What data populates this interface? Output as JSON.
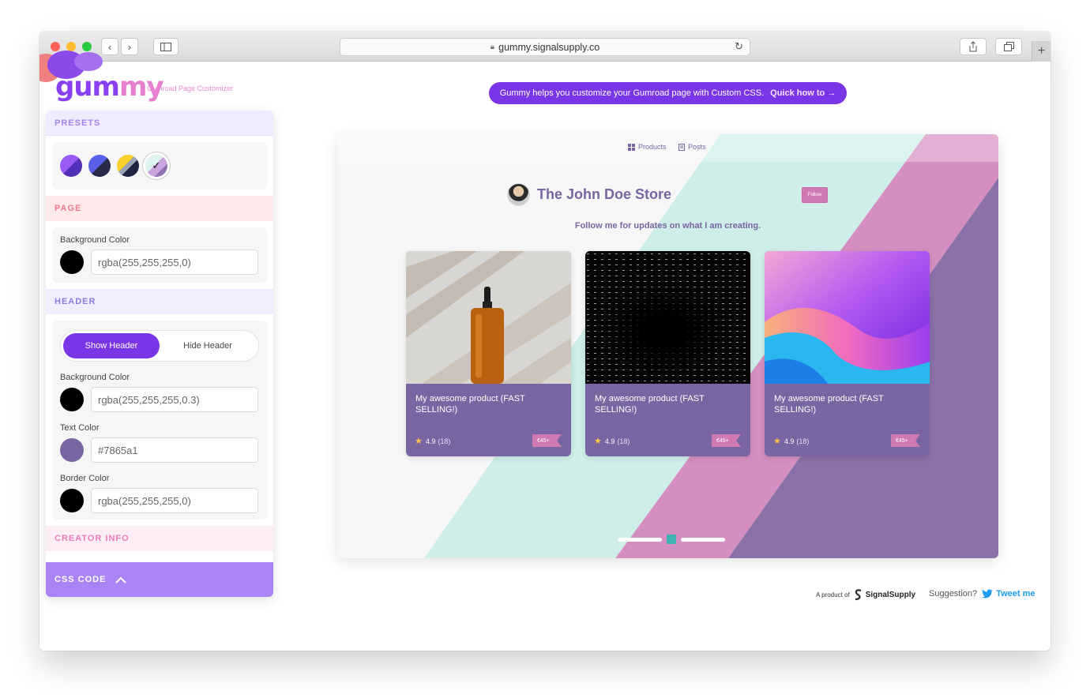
{
  "browser": {
    "url": "gummy.signalsupply.co"
  },
  "logo": {
    "name_a": "gum",
    "name_b": "my",
    "tagline": "Gumroad Page Customizer"
  },
  "sidebar": {
    "presets_title": "PRESETS",
    "page_title": "PAGE",
    "page": {
      "bg_label": "Background Color",
      "bg_value": "rgba(255,255,255,0)"
    },
    "header_title": "HEADER",
    "header": {
      "show_label": "Show Header",
      "hide_label": "Hide Header",
      "bg_label": "Background Color",
      "bg_value": "rgba(255,255,255,0.3)",
      "text_label": "Text Color",
      "text_value": "#7865a1",
      "border_label": "Border Color",
      "border_value": "rgba(255,255,255,0)"
    },
    "creator_title": "CREATOR INFO",
    "css_code_label": "CSS CODE"
  },
  "banner": {
    "text": "Gummy helps you customize your Gumroad page with Custom CSS.",
    "link": "Quick how to →"
  },
  "preview": {
    "nav_products": "Products",
    "nav_posts": "Posts",
    "store_name": "The John Doe Store",
    "follow_label": "Follow",
    "bio": "Follow me for updates on what I am creating.",
    "products": [
      {
        "title": "My awesome product (FAST SELLING!)",
        "rating": "4.9",
        "count": "(18)",
        "price": "€45+"
      },
      {
        "title": "My awesome product (FAST SELLING!)",
        "rating": "4.9",
        "count": "(18)",
        "price": "€45+"
      },
      {
        "title": "My awesome product (FAST SELLING!)",
        "rating": "4.9",
        "count": "(18)",
        "price": "€45+"
      }
    ]
  },
  "footer": {
    "product_of": "A product of",
    "brand": "SignalSupply",
    "suggestion": "Suggestion?",
    "tweet": "Tweet me"
  },
  "colors": {
    "accent": "#7a35e6",
    "text_color": "#7865a1",
    "pink": "#d07ab4",
    "mint": "#cdeeea"
  }
}
